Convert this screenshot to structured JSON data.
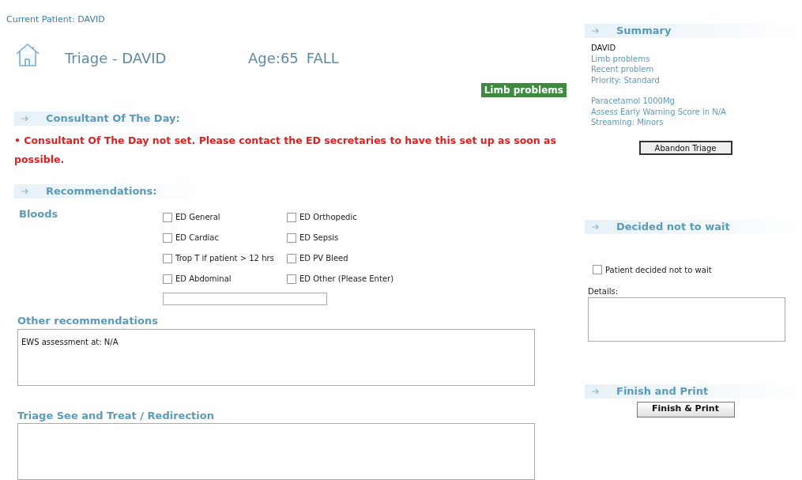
{
  "current_patient": "Current Patient: DAVID",
  "header": {
    "title": "Triage - DAVID",
    "age": "Age:65",
    "complaint": "FALL"
  },
  "badge": "Limb problems",
  "consultant": {
    "heading": "Consultant Of The Day:",
    "error": "• Consultant Of The Day not set. Please contact the ED secretaries to have this set up as soon as possible."
  },
  "recommendations": {
    "heading": "Recommendations:",
    "bloods_label": "Bloods",
    "bloods": [
      {
        "label": "ED General",
        "checked": false
      },
      {
        "label": "ED Orthopedic",
        "checked": false
      },
      {
        "label": "ED Cardiac",
        "checked": false
      },
      {
        "label": "ED Sepsis",
        "checked": false
      },
      {
        "label": "Trop T if patient > 12 hrs",
        "checked": false
      },
      {
        "label": "ED PV Bleed",
        "checked": false
      },
      {
        "label": "ED Abdominal",
        "checked": false
      },
      {
        "label": "ED Other (Please Enter)",
        "checked": false
      }
    ],
    "other_label": "Other recommendations",
    "other_value": "EWS assessment at: N/A",
    "see_treat_label": "Triage See and Treat / Redirection"
  },
  "summary": {
    "heading": "Summary",
    "name": "DAVID",
    "lines": [
      "Limb problems",
      "Recent problem",
      "Priority: Standard"
    ],
    "lines2": [
      "Paracetamol 1000Mg",
      "Assess Early Warning Score in N/A",
      "Streaming: Minors"
    ],
    "button": "Abandon Triage"
  },
  "not_wait": {
    "heading": "Decided not to wait",
    "checkbox": {
      "label": "Patient decided not to wait",
      "checked": false
    },
    "details_label": "Details:"
  },
  "finish": {
    "heading": "Finish and Print",
    "button": "Finish & Print"
  }
}
